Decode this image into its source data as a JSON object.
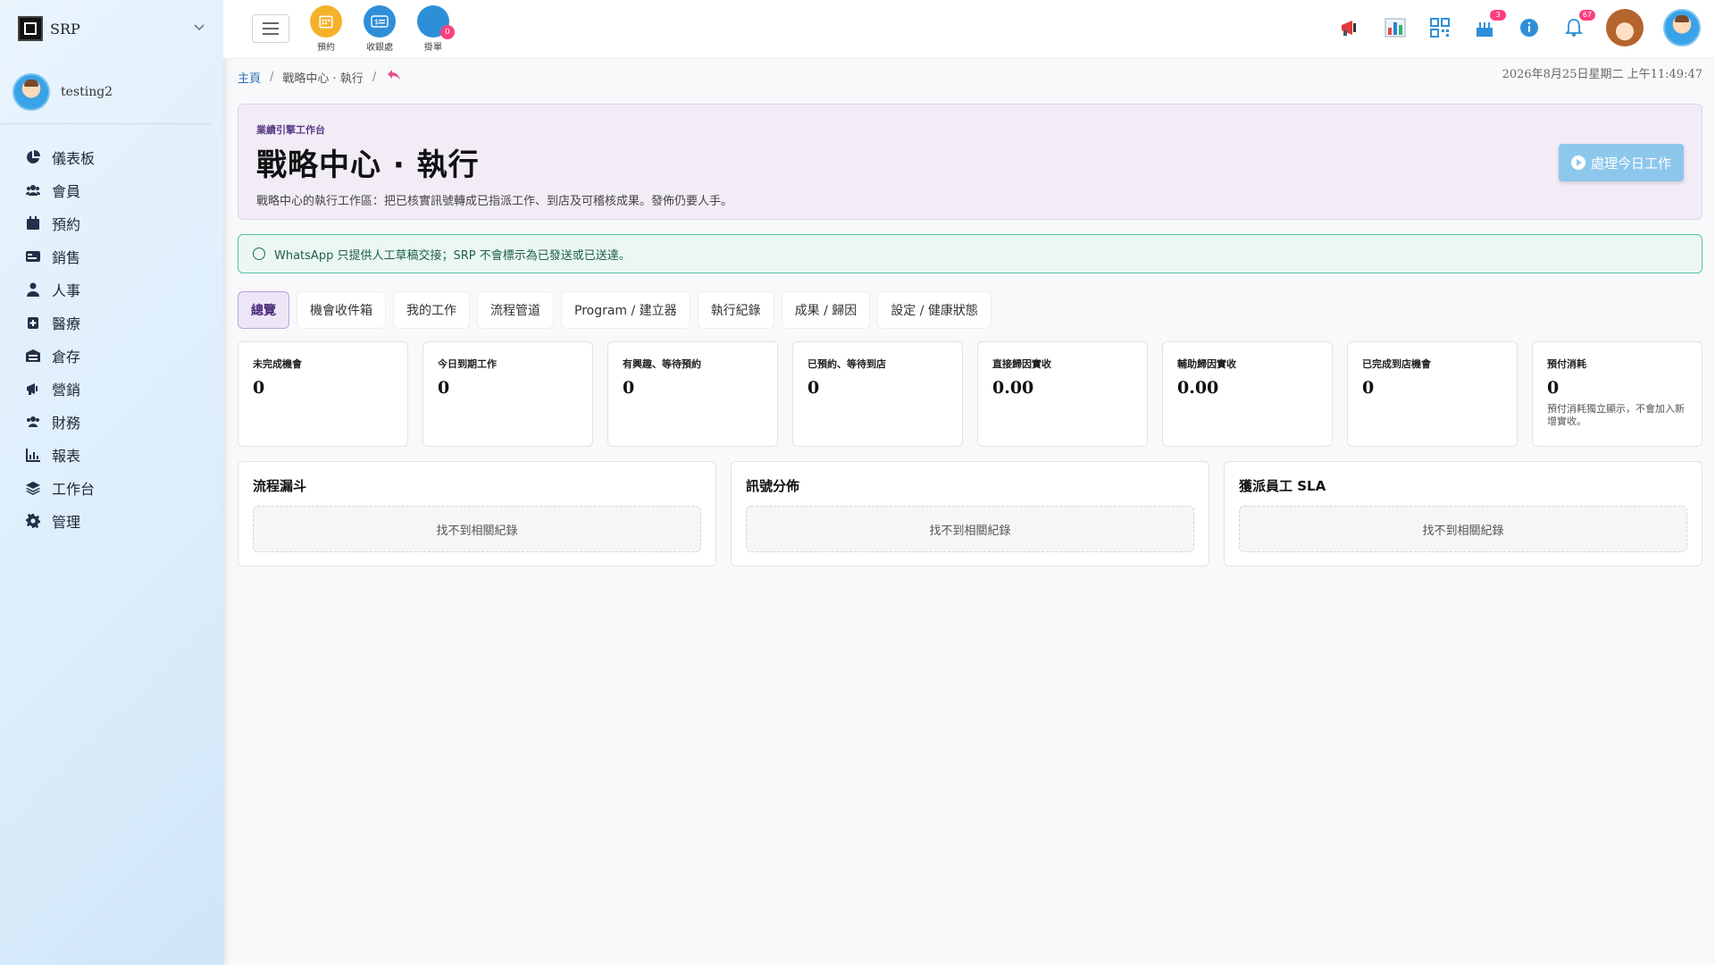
{
  "brand": {
    "name": "SRP"
  },
  "user": {
    "name": "testing2"
  },
  "sidebar": {
    "items": [
      {
        "label": "儀表板",
        "icon": "pie-chart-icon"
      },
      {
        "label": "會員",
        "icon": "users-icon"
      },
      {
        "label": "預約",
        "icon": "calendar-icon"
      },
      {
        "label": "銷售",
        "icon": "card-icon"
      },
      {
        "label": "人事",
        "icon": "person-icon"
      },
      {
        "label": "醫療",
        "icon": "medical-icon"
      },
      {
        "label": "倉存",
        "icon": "warehouse-icon"
      },
      {
        "label": "營銷",
        "icon": "megaphone-icon"
      },
      {
        "label": "財務",
        "icon": "finance-users-icon"
      },
      {
        "label": "報表",
        "icon": "bar-chart-icon"
      },
      {
        "label": "工作台",
        "icon": "layers-icon"
      },
      {
        "label": "管理",
        "icon": "gear-icon"
      }
    ]
  },
  "topbar": {
    "quick": [
      {
        "label": "預約",
        "color": "#f5b12a"
      },
      {
        "label": "收銀處",
        "color": "#2e8fd8"
      },
      {
        "label": "掛單",
        "color": "#2e8fd8",
        "badge": "0"
      }
    ],
    "badges": {
      "cake": "3",
      "bell": "67"
    }
  },
  "breadcrumb": {
    "home": "主頁",
    "current": "戰略中心 · 執行"
  },
  "datetime": "2026年8月25日星期二 上午11:49:47",
  "hero": {
    "eyebrow": "業績引擎工作台",
    "title": "戰略中心 · 執行",
    "subtitle": "戰略中心的執行工作區：把已核實訊號轉成已指派工作、到店及可稽核成果。發佈仍要人手。",
    "button": "處理今日工作"
  },
  "notice": "WhatsApp 只提供人工草稿交接；SRP 不會標示為已發送或已送達。",
  "tabs": [
    "總覽",
    "機會收件箱",
    "我的工作",
    "流程管道",
    "Program / 建立器",
    "執行紀錄",
    "成果 / 歸因",
    "設定 / 健康狀態"
  ],
  "stats": [
    {
      "label": "未完成機會",
      "value": "0"
    },
    {
      "label": "今日到期工作",
      "value": "0"
    },
    {
      "label": "有興趣、等待預約",
      "value": "0"
    },
    {
      "label": "已預約、等待到店",
      "value": "0"
    },
    {
      "label": "直接歸因實收",
      "value": "0.00"
    },
    {
      "label": "輔助歸因實收",
      "value": "0.00"
    },
    {
      "label": "已完成到店機會",
      "value": "0"
    },
    {
      "label": "預付消耗",
      "value": "0",
      "note": "預付消耗獨立顯示，不會加入新增實收。"
    }
  ],
  "panels": [
    {
      "title": "流程漏斗",
      "empty": "找不到相關紀錄"
    },
    {
      "title": "訊號分佈",
      "empty": "找不到相關紀錄"
    },
    {
      "title": "獲派員工 SLA",
      "empty": "找不到相關紀錄"
    }
  ]
}
